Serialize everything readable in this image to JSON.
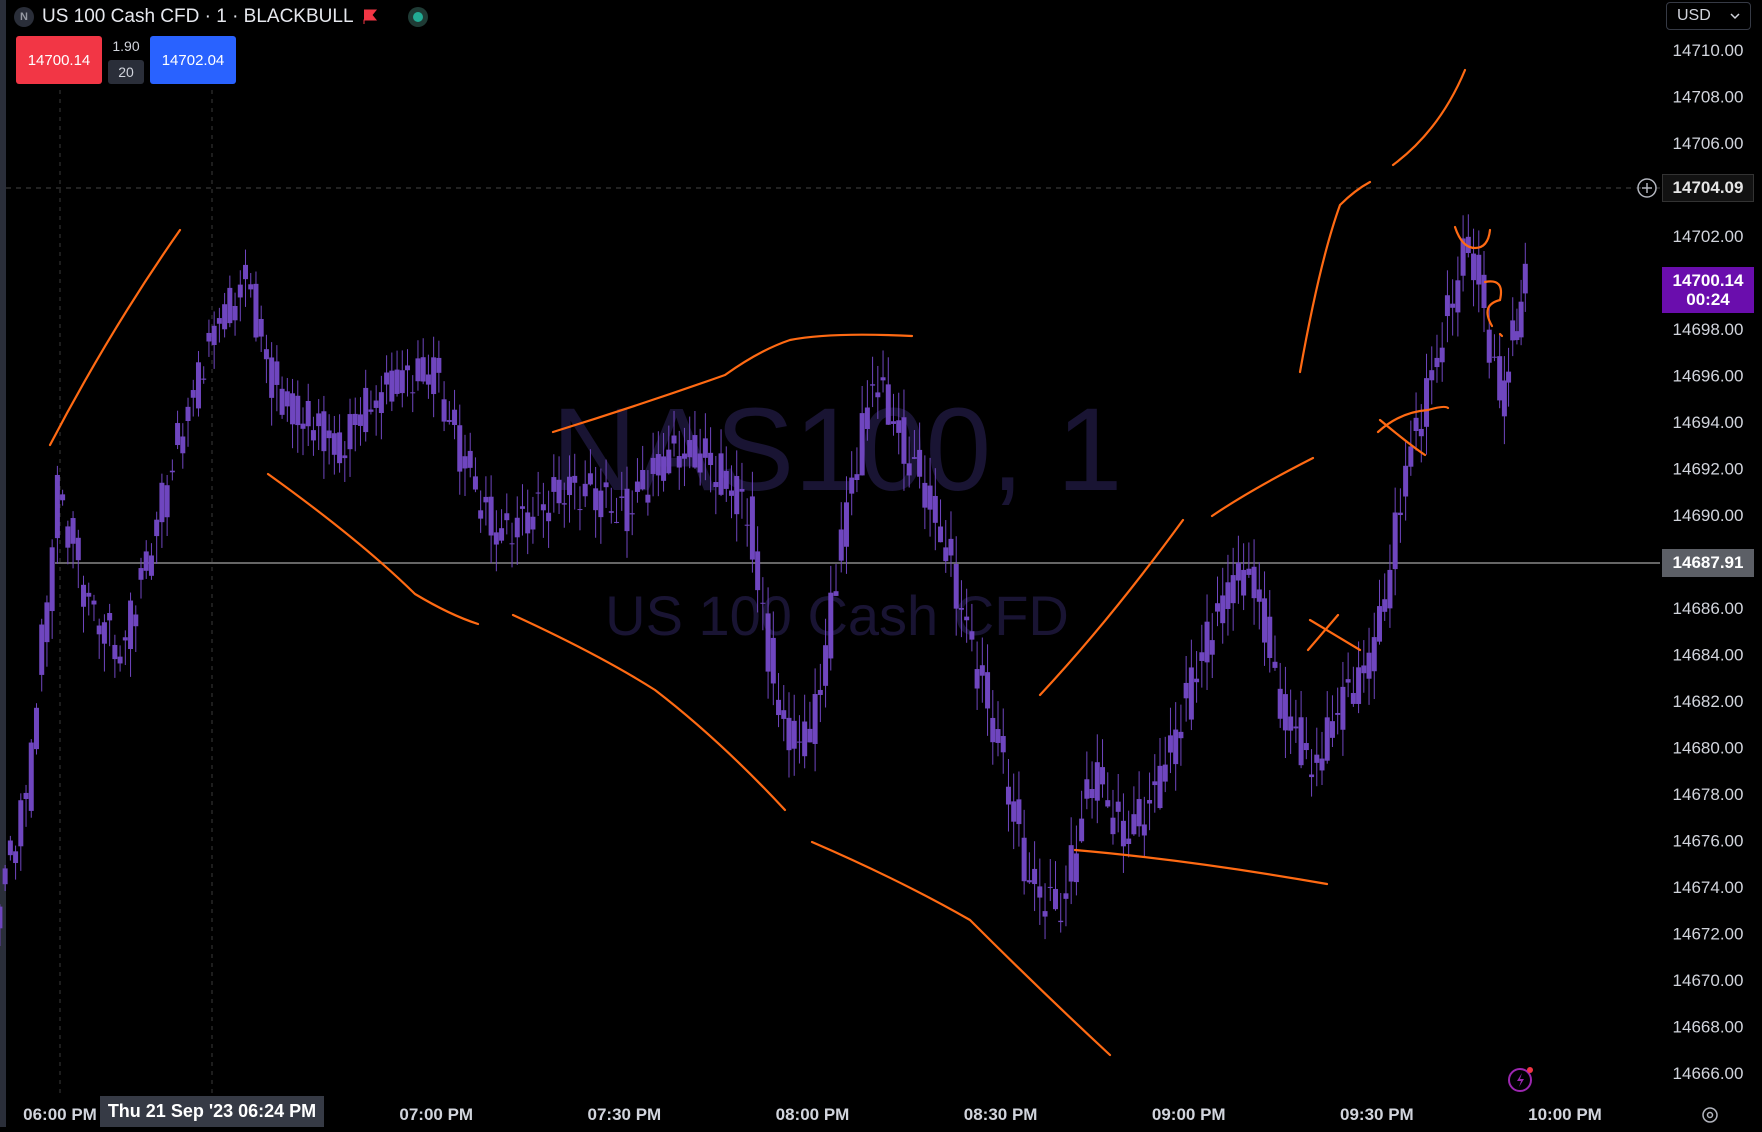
{
  "header": {
    "symbol_badge": "N",
    "title": "US 100 Cash CFD · 1 · BLACKBULL",
    "icons": [
      "flag-icon",
      "status-dot-icon"
    ]
  },
  "trade_panel": {
    "sell_price": "14700.14",
    "spread": "1.90",
    "quantity": "20",
    "buy_price": "14702.04"
  },
  "currency_select": {
    "value": "USD"
  },
  "watermark": {
    "line1": "NAS100, 1",
    "line2": "US 100 Cash CFD"
  },
  "price_labels": {
    "level": "14704.09",
    "last_price": "14700.14",
    "countdown": "00:24",
    "crosshair_price": "14687.91"
  },
  "crosshair_time": "Thu 21 Sep '23   06:24 PM",
  "annotation_glyph": "?",
  "colors": {
    "background": "#000000",
    "candle": "#6f46bf",
    "drawing": "#ff6a13",
    "sell": "#f23645",
    "buy": "#2962ff",
    "last_price": "#6a0dad"
  },
  "chart_data": {
    "type": "line",
    "title": "NAS100, 1",
    "subtitle": "US 100 Cash CFD",
    "xlabel": "",
    "ylabel": "",
    "grid": false,
    "x_ticks": [
      "06:00 PM",
      "07:00 PM",
      "07:30 PM",
      "08:00 PM",
      "08:30 PM",
      "09:00 PM",
      "09:30 PM",
      "10:00 PM"
    ],
    "y_ticks": [
      14710,
      14708,
      14706,
      14704,
      14702,
      14700,
      14698,
      14696,
      14694,
      14692,
      14690,
      14688,
      14686,
      14684,
      14682,
      14680,
      14678,
      14676,
      14674,
      14672,
      14670,
      14668,
      14666
    ],
    "ylim": [
      14665,
      14711
    ],
    "x_range_minutes": [
      "05:44 PM",
      "10:02 PM"
    ],
    "series": [
      {
        "x": [
          "05:45 PM",
          "05:50 PM",
          "05:55 PM",
          "06:00 PM",
          "06:05 PM",
          "06:10 PM",
          "06:15 PM",
          "06:20 PM",
          "06:25 PM",
          "06:30 PM",
          "06:35 PM",
          "06:40 PM",
          "06:45 PM",
          "06:50 PM",
          "06:55 PM",
          "07:00 PM",
          "07:05 PM",
          "07:10 PM",
          "07:15 PM",
          "07:20 PM",
          "07:25 PM",
          "07:30 PM",
          "07:35 PM",
          "07:40 PM",
          "07:45 PM",
          "07:50 PM",
          "07:55 PM",
          "08:00 PM",
          "08:05 PM",
          "08:10 PM",
          "08:15 PM",
          "08:20 PM",
          "08:25 PM",
          "08:30 PM",
          "08:35 PM",
          "08:40 PM",
          "08:45 PM",
          "08:50 PM",
          "08:55 PM",
          "09:00 PM",
          "09:05 PM",
          "09:10 PM",
          "09:15 PM",
          "09:20 PM",
          "09:25 PM",
          "09:30 PM",
          "09:35 PM",
          "09:40 PM",
          "09:45 PM",
          "09:50 PM",
          "09:54 PM"
        ],
        "values": [
          14676,
          14673,
          14678,
          14691,
          14686,
          14684,
          14689,
          14694,
          14698,
          14700,
          14695,
          14694,
          14693,
          14695,
          14696,
          14696,
          14692,
          14689,
          14690,
          14691,
          14691,
          14690,
          14692,
          14693,
          14692,
          14690,
          14681,
          14680,
          14689,
          14696,
          14693,
          14690,
          14685,
          14680,
          14674,
          14673,
          14679,
          14676,
          14678,
          14682,
          14686,
          14688,
          14682,
          14679,
          14682,
          14684,
          14692,
          14697,
          14702,
          14695,
          14700.14
        ]
      }
    ]
  }
}
